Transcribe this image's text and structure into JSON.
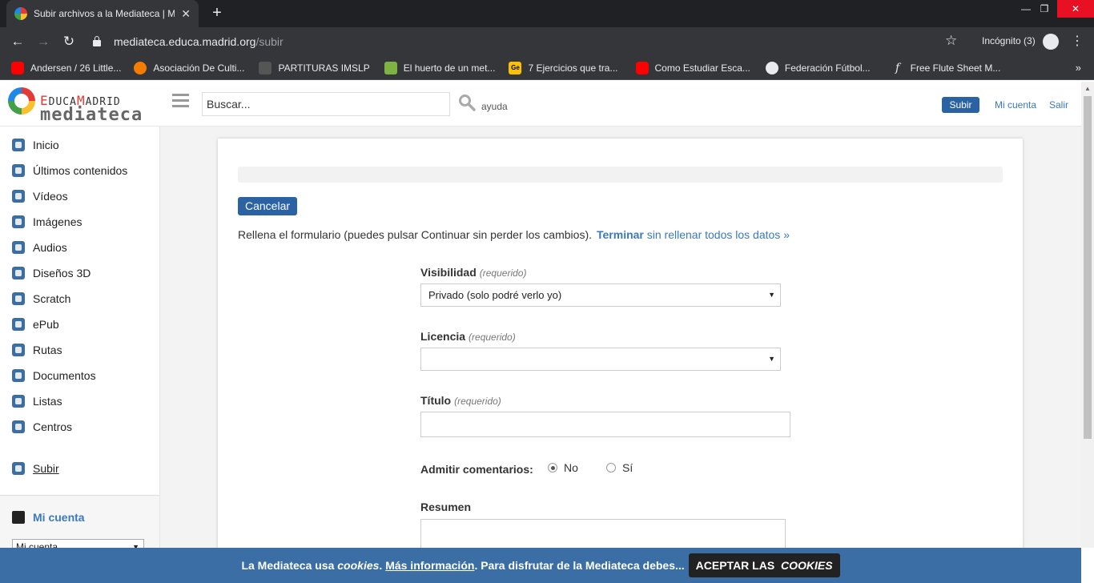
{
  "browser": {
    "tab_title": "Subir archivos a la Mediateca | M",
    "tab_close": "✕",
    "new_tab": "+",
    "url_host": "mediateca.educa.madrid.org",
    "url_path": "/subir",
    "incognito_label": "Incógnito (3)",
    "bookmarks": [
      {
        "label": "Andersen / 26 Little...",
        "icon": "youtube-icon"
      },
      {
        "label": "Asociación De Culti...",
        "icon": "orange-circle-icon"
      },
      {
        "label": "PARTITURAS IMSLP",
        "icon": "imslp-icon"
      },
      {
        "label": "El huerto de un met...",
        "icon": "leaf-icon"
      },
      {
        "label": "7 Ejercicios que tra...",
        "icon": "ge-icon"
      },
      {
        "label": "Como Estudiar Esca...",
        "icon": "youtube-icon"
      },
      {
        "label": "Federación Fútbol...",
        "icon": "globe-icon"
      },
      {
        "label": "Free Flute Sheet M...",
        "icon": "flute-icon"
      }
    ],
    "bookmarks_more": "»"
  },
  "header": {
    "logo_top_e": "E",
    "logo_top_1": "DUCA",
    "logo_top_m": "M",
    "logo_top_2": "ADRID",
    "logo_bottom": "mediateca",
    "search_placeholder": "Buscar...",
    "help": "ayuda",
    "upload_button": "Subir",
    "my_account": "Mi cuenta",
    "logout": "Salir"
  },
  "sidebar": {
    "items": [
      {
        "label": "Inicio",
        "icon": "home-icon"
      },
      {
        "label": "Últimos contenidos",
        "icon": "clock-icon"
      },
      {
        "label": "Vídeos",
        "icon": "video-icon"
      },
      {
        "label": "Imágenes",
        "icon": "camera-icon"
      },
      {
        "label": "Audios",
        "icon": "audio-icon"
      },
      {
        "label": "Diseños 3D",
        "icon": "cube-icon"
      },
      {
        "label": "Scratch",
        "icon": "scratch-icon"
      },
      {
        "label": "ePub",
        "icon": "epub-icon"
      },
      {
        "label": "Rutas",
        "icon": "flag-icon"
      },
      {
        "label": "Documentos",
        "icon": "document-icon"
      },
      {
        "label": "Listas",
        "icon": "list-icon"
      },
      {
        "label": "Centros",
        "icon": "building-icon"
      }
    ],
    "upload": "Subir",
    "account_title": "Mi cuenta",
    "account_select": "Mi cuenta"
  },
  "form": {
    "cancel": "Cancelar",
    "intro": "Rellena el formulario (puedes pulsar Continuar sin perder los cambios).",
    "finish_bold": "Terminar",
    "finish_rest": " sin rellenar todos los datos »",
    "required": "(requerido)",
    "visibility_label": "Visibilidad",
    "visibility_value": "Privado (solo podré verlo yo)",
    "license_label": "Licencia",
    "license_value": "",
    "title_label": "Título",
    "comments_label": "Admitir comentarios:",
    "comments_no": "No",
    "comments_yes": "Sí",
    "comments_selected": "No",
    "summary_label": "Resumen"
  },
  "cookie_banner": {
    "text_1": "La Mediateca usa ",
    "text_cookies": "cookies",
    "text_2": ". ",
    "more_info": "Más información",
    "text_3": ". Para disfrutar de la Mediateca debes...",
    "accept_1": "ACEPTAR LAS ",
    "accept_cookies": "COOKIES"
  },
  "colors": {
    "primary": "#2a62a4",
    "link": "#3a78bf",
    "banner": "#3a6ea5"
  }
}
